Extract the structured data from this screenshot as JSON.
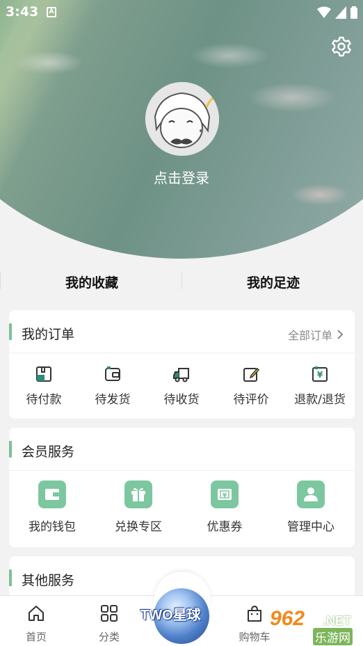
{
  "status_bar": {
    "time": "3:43",
    "notification_icon": "A"
  },
  "header": {
    "login_text": "点击登录",
    "settings_icon": "gear-icon"
  },
  "quick_links": {
    "favorites": "我的收藏",
    "footprints": "我的足迹"
  },
  "orders": {
    "title": "我的订单",
    "all_orders": "全部订单",
    "items": [
      {
        "label": "待付款",
        "icon": "pending-payment-icon"
      },
      {
        "label": "待发货",
        "icon": "pending-shipment-icon"
      },
      {
        "label": "待收货",
        "icon": "pending-receipt-icon"
      },
      {
        "label": "待评价",
        "icon": "pending-review-icon"
      },
      {
        "label": "退款/退货",
        "icon": "refund-icon"
      }
    ]
  },
  "member_services": {
    "title": "会员服务",
    "items": [
      {
        "label": "我的钱包",
        "icon": "wallet-icon"
      },
      {
        "label": "兑换专区",
        "icon": "gift-icon"
      },
      {
        "label": "优惠券",
        "icon": "coupon-icon"
      },
      {
        "label": "管理中心",
        "icon": "user-icon"
      }
    ]
  },
  "other_services": {
    "title": "其他服务"
  },
  "bottom_nav": {
    "items": [
      {
        "label": "首页",
        "icon": "home-icon"
      },
      {
        "label": "分类",
        "icon": "grid-icon"
      },
      {
        "label": "购物车",
        "icon": "bag-icon"
      }
    ],
    "center_logo": "TWO星球"
  },
  "watermark": {
    "number": "962",
    "net": ".NET",
    "site": "乐游网"
  },
  "colors": {
    "accent": "#7cc099",
    "member_icon_bg": "#7cc7a0",
    "background": "#f2f2f2"
  }
}
